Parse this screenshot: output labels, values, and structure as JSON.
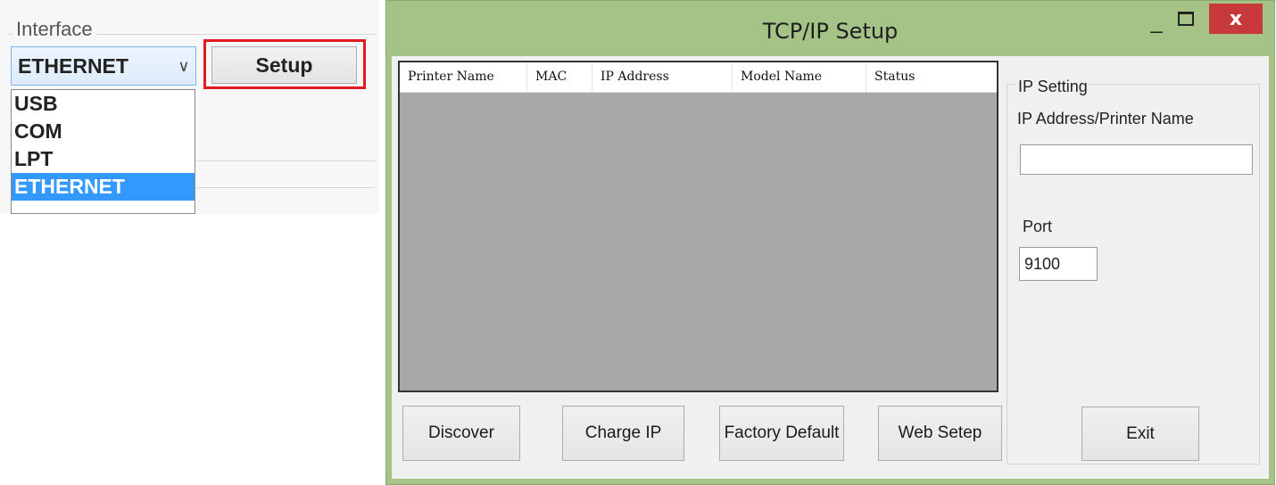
{
  "interface_panel": {
    "label": "Interface",
    "selected_value": "ETHERNET",
    "setup_button": "Setup",
    "dropdown_options": [
      "USB",
      "COM",
      "LPT",
      "ETHERNET"
    ],
    "highlight_color": "#e01b22"
  },
  "window": {
    "title": "TCP/IP Setup",
    "minimize_symbol": "_",
    "close_symbol": "x",
    "frame_color": "#a5c386"
  },
  "printer_list": {
    "columns": [
      "Printer Name",
      "MAC",
      "IP Address",
      "Model Name",
      "Status"
    ],
    "rows": []
  },
  "buttons": {
    "discover": "Discover",
    "charge_ip": "Charge IP",
    "factory_default": "Factory Default",
    "web_setup": "Web Setep",
    "exit": "Exit"
  },
  "ip_setting": {
    "group_label": "IP Setting",
    "address_label": "IP Address/Printer Name",
    "address_value": "",
    "port_label": "Port",
    "port_value": "9100"
  }
}
